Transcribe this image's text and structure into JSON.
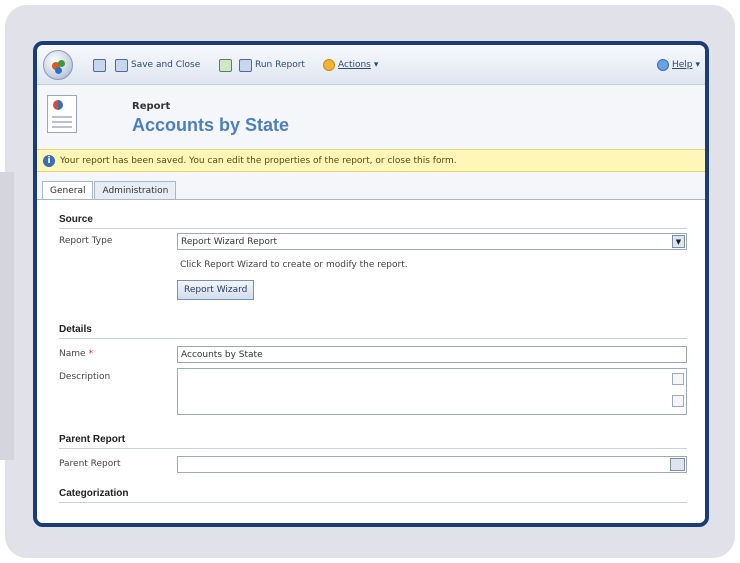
{
  "ribbon": {
    "save_close_label": "Save and Close",
    "run_report_label": "Run Report",
    "actions_label": "Actions",
    "help_label": "Help"
  },
  "header": {
    "entity_type": "Report",
    "title": "Accounts by State"
  },
  "notice": {
    "text": "Your report has been saved. You can edit the properties of the report, or close this form."
  },
  "tabs": [
    {
      "label": "General"
    },
    {
      "label": "Administration"
    }
  ],
  "form": {
    "source": {
      "title": "Source",
      "report_type_label": "Report Type",
      "report_type_value": "Report Wizard Report",
      "hint": "Click Report Wizard to create or modify the report.",
      "wizard_button": "Report Wizard"
    },
    "details": {
      "title": "Details",
      "name_label": "Name",
      "name_value": "Accounts by State",
      "description_label": "Description"
    },
    "parent": {
      "title": "Parent Report",
      "parent_label": "Parent Report"
    },
    "categorization": {
      "title": "Categorization"
    }
  }
}
